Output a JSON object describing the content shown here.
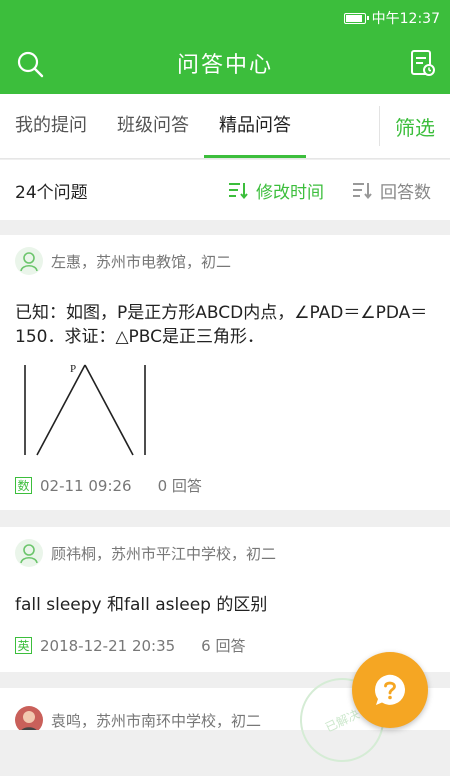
{
  "status": {
    "time": "中午12:37"
  },
  "header": {
    "title": "问答中心"
  },
  "tabs": [
    {
      "label": "我的提问"
    },
    {
      "label": "班级问答"
    },
    {
      "label": "精品问答"
    }
  ],
  "filter_label": "筛选",
  "sort": {
    "count": "24个问题",
    "by_time": "修改时间",
    "by_answers": "回答数"
  },
  "questions": [
    {
      "author": "左惠，苏州市电教馆，初二",
      "text": "已知：如图，P是正方形ABCD内点，∠PAD＝∠PDA＝150．求证：△PBC是正三角形．",
      "figure_label": "P",
      "subject": "数",
      "date": "02-11 09:26",
      "answers": "0 回答"
    },
    {
      "author": "顾祎桐，苏州市平江中学校，初二",
      "text": "fall sleepy 和fall asleep 的区别",
      "subject": "英",
      "date": "2018-12-21 20:35",
      "answers": "6 回答"
    },
    {
      "author": "袁鸣，苏州市南环中学校，初二"
    }
  ],
  "stamp_text": "已解决",
  "colors": {
    "primary": "#3cbe3c",
    "fab": "#f5a623"
  }
}
